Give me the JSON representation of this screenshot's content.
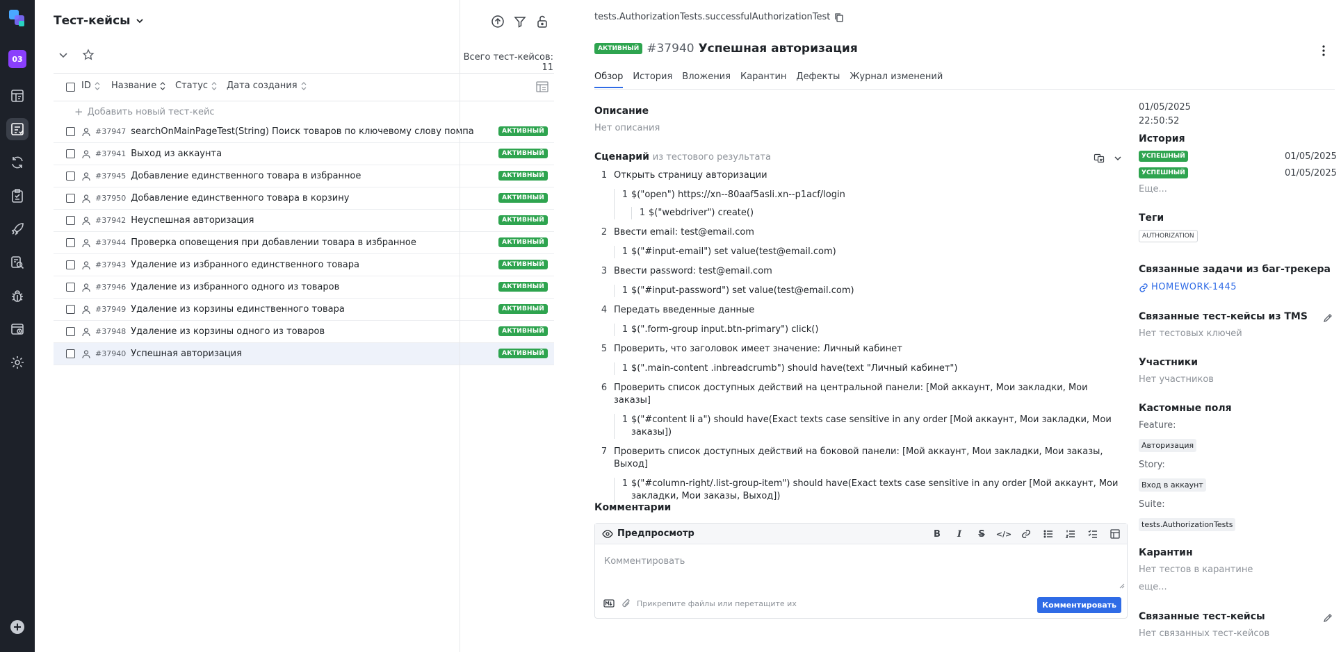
{
  "sidebar": {
    "project_badge": "03",
    "icons": [
      "dashboard-icon",
      "test-cases-icon",
      "launches-icon",
      "test-plans-icon",
      "rocket-icon",
      "search-analytics-icon",
      "defects-icon",
      "jobs-icon",
      "settings-icon"
    ],
    "active_index": 1
  },
  "list": {
    "title": "Тест-кейсы",
    "total_label": "Всего тест-кейсов: 11",
    "columns": {
      "id": "ID",
      "name": "Название",
      "status": "Статус",
      "created": "Дата создания"
    },
    "add_label": "Добавить новый тест-кейс",
    "rows": [
      {
        "id": "#37947",
        "name": "searchOnMainPageTest(String) Поиск товаров по ключевому слову помпа",
        "status": "АКТИВНЫЙ"
      },
      {
        "id": "#37941",
        "name": "Выход из аккаунта",
        "status": "АКТИВНЫЙ"
      },
      {
        "id": "#37945",
        "name": "Добавление единственного товара в избранное",
        "status": "АКТИВНЫЙ"
      },
      {
        "id": "#37950",
        "name": "Добавление единственного товара в корзину",
        "status": "АКТИВНЫЙ"
      },
      {
        "id": "#37942",
        "name": "Неуспешная авторизация",
        "status": "АКТИВНЫЙ"
      },
      {
        "id": "#37944",
        "name": "Проверка оповещения при добавлении товара в избранное",
        "status": "АКТИВНЫЙ"
      },
      {
        "id": "#37943",
        "name": "Удаление из избранного единственного товара",
        "status": "АКТИВНЫЙ"
      },
      {
        "id": "#37946",
        "name": "Удаление из избранного одного из товаров",
        "status": "АКТИВНЫЙ"
      },
      {
        "id": "#37949",
        "name": "Удаление из корзины единственного товара",
        "status": "АКТИВНЫЙ"
      },
      {
        "id": "#37948",
        "name": "Удаление из корзины одного из товаров",
        "status": "АКТИВНЫЙ"
      },
      {
        "id": "#37940",
        "name": "Успешная авторизация",
        "status": "АКТИВНЫЙ",
        "selected": true
      }
    ]
  },
  "detail": {
    "path": "tests.AuthorizationTests.successfulAuthorizationTest",
    "status_badge": "АКТИВНЫЙ",
    "number": "#37940",
    "name": "Успешная авторизация",
    "tabs": [
      "Обзор",
      "История",
      "Вложения",
      "Карантин",
      "Дефекты",
      "Журнал изменений"
    ],
    "active_tab": "Обзор",
    "description_title": "Описание",
    "description_empty": "Нет описания",
    "scenario_title": "Сценарий",
    "scenario_source": "из тестового результата",
    "steps": [
      {
        "n": "1",
        "text": "Открыть страницу авторизации",
        "sub": [
          {
            "n": "1",
            "text": "$(\"open\") https://xn--80aaf5asli.xn--p1acf/login",
            "sub": [
              {
                "n": "1",
                "text": "$(\"webdriver\") create()"
              }
            ]
          }
        ]
      },
      {
        "n": "2",
        "text": "Ввести email: test@email.com",
        "sub": [
          {
            "n": "1",
            "text": "$(\"#input-email\") set value(test@email.com)"
          }
        ]
      },
      {
        "n": "3",
        "text": "Ввести password: test@email.com",
        "sub": [
          {
            "n": "1",
            "text": "$(\"#input-password\") set value(test@email.com)"
          }
        ]
      },
      {
        "n": "4",
        "text": "Передать введенные данные",
        "sub": [
          {
            "n": "1",
            "text": "$(\".form-group input.btn-primary\") click()"
          }
        ]
      },
      {
        "n": "5",
        "text": "Проверить, что заголовок имеет значение: Личный кабинет",
        "sub": [
          {
            "n": "1",
            "text": "$(\".main-content .inbreadcrumb\") should have(text \"Личный кабинет\")"
          }
        ]
      },
      {
        "n": "6",
        "text": "Проверить список доступных действий на центральной панели: [Мой аккаунт, Мои закладки, Мои заказы]",
        "sub": [
          {
            "n": "1",
            "text": "$(\"#content li a\") should have(Exact texts case sensitive in any order [Мой аккаунт, Мои закладки, Мои заказы])"
          }
        ]
      },
      {
        "n": "7",
        "text": "Проверить список доступных действий на боковой панели: [Мой аккаунт, Мои закладки, Мои заказы, Выход]",
        "sub": [
          {
            "n": "1",
            "text": "$(\"#column-right/.list-group-item\") should have(Exact texts case sensitive in any order [Мой аккаунт, Мои закладки, Мои заказы, Выход])"
          }
        ]
      }
    ],
    "comments_title": "Комментарии",
    "editor": {
      "preview_label": "Предпросмотр",
      "placeholder": "Комментировать",
      "attach_hint": "Прикрепите файлы или перетащите их",
      "submit_label": "Комментировать"
    }
  },
  "meta": {
    "date": "01/05/2025",
    "time": "22:50:52",
    "history_title": "История",
    "history": [
      {
        "status": "УСПЕШНЫЙ",
        "date": "01/05/2025"
      },
      {
        "status": "УСПЕШНЫЙ",
        "date": "01/05/2025"
      }
    ],
    "history_more": "Еще...",
    "tags_title": "Теги",
    "tag": "AUTHORIZATION",
    "issues_title": "Связанные задачи из баг-трекера",
    "issue_link": "HOMEWORK-1445",
    "tms_title": "Связанные тест-кейсы из TMS",
    "tms_empty": "Нет тестовых ключей",
    "members_title": "Участники",
    "members_empty": "Нет участников",
    "custom_title": "Кастомные поля",
    "feature_label": "Feature:",
    "feature_value": "Авторизация",
    "story_label": "Story:",
    "story_value": "Вход в аккаунт",
    "suite_label": "Suite:",
    "suite_value": "tests.AuthorizationTests",
    "quarantine_title": "Карантин",
    "quarantine_empty": "Нет тестов в карантине",
    "quarantine_more": "еще...",
    "related_title": "Связанные тест-кейсы",
    "related_empty": "Нет связанных тест-кейсов"
  },
  "colors": {
    "sidebar_bg": "#1d2129",
    "accent": "#2f6be6",
    "success": "#2ea44f",
    "project": "#8a3ffc"
  }
}
